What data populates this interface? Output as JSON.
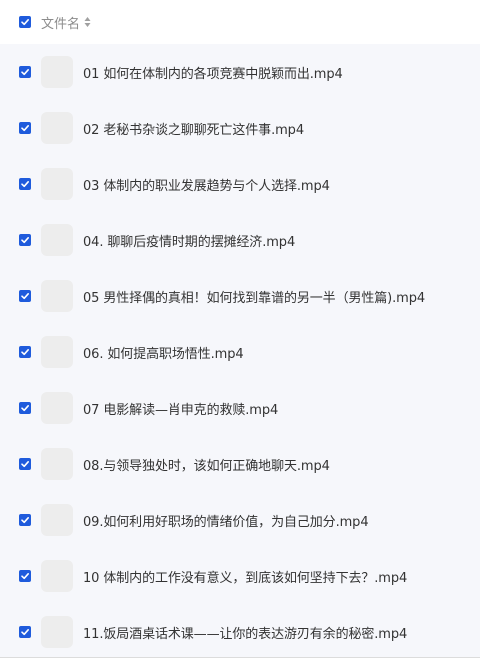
{
  "header": {
    "column_label": "文件名",
    "sort_icon": "sort-icon",
    "select_all_checked": true
  },
  "colors": {
    "checkbox": "#1f5bdc",
    "list_background": "#f6f7fb",
    "thumbnail": "#ededed"
  },
  "files": [
    {
      "name": "01 如何在体制内的各项竞赛中脱颖而出.mp4",
      "checked": true
    },
    {
      "name": "02 老秘书杂谈之聊聊死亡这件事.mp4",
      "checked": true
    },
    {
      "name": "03 体制内的职业发展趋势与个人选择.mp4",
      "checked": true
    },
    {
      "name": "04. 聊聊后疫情时期的摆摊经济.mp4",
      "checked": true
    },
    {
      "name": "05 男性择偶的真相！如何找到靠谱的另一半（男性篇).mp4",
      "checked": true
    },
    {
      "name": "06. 如何提高职场悟性.mp4",
      "checked": true
    },
    {
      "name": "07 电影解读—肖申克的救赎.mp4",
      "checked": true
    },
    {
      "name": "08.与领导独处时，该如何正确地聊天.mp4",
      "checked": true
    },
    {
      "name": "09.如何利用好职场的情绪价值，为自己加分.mp4",
      "checked": true
    },
    {
      "name": "10 体制内的工作没有意义，到底该如何坚持下去？.mp4",
      "checked": true
    },
    {
      "name": "11.饭局酒桌话术课——让你的表达游刃有余的秘密.mp4",
      "checked": true
    }
  ]
}
